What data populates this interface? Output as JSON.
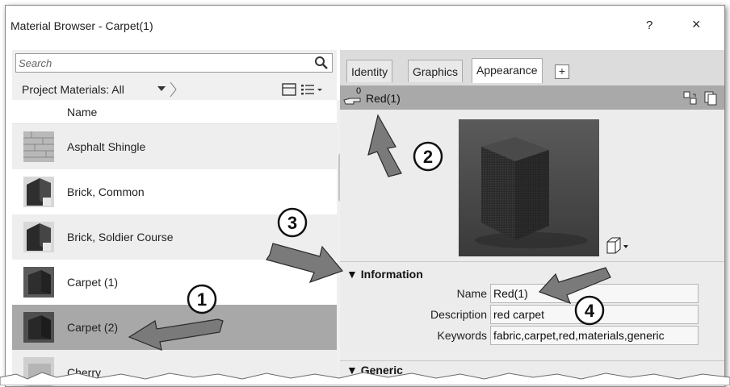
{
  "window": {
    "title": "Material Browser - Carpet(1)",
    "help": "?",
    "close": "×"
  },
  "search": {
    "placeholder": "Search"
  },
  "filter": {
    "label": "Project Materials: All"
  },
  "list": {
    "column_header": "Name",
    "items": [
      {
        "label": "Asphalt Shingle",
        "selected": false
      },
      {
        "label": "Brick, Common",
        "selected": false
      },
      {
        "label": "Brick, Soldier Course",
        "selected": false
      },
      {
        "label": "Carpet (1)",
        "selected": false
      },
      {
        "label": "Carpet (2)",
        "selected": true
      },
      {
        "label": "Cherry",
        "selected": false
      }
    ]
  },
  "tabs": [
    {
      "label": "Identity",
      "active": false
    },
    {
      "label": "Graphics",
      "active": false
    },
    {
      "label": "Appearance",
      "active": true
    }
  ],
  "tab_add": "+",
  "asset": {
    "count": "0",
    "name": "Red(1)"
  },
  "information": {
    "header": "Information",
    "name_label": "Name",
    "name_value": "Red(1)",
    "description_label": "Description",
    "description_value": "red carpet",
    "keywords_label": "Keywords",
    "keywords_value": "fabric,carpet,red,materials,generic"
  },
  "generic": {
    "header": "Generic"
  },
  "callouts": [
    "1",
    "2",
    "3",
    "4"
  ],
  "colors": {
    "selected_row": "#a8a8a8",
    "alt_row": "#eeeeee",
    "asset_bar": "#a9a9a9",
    "callout_arrow": "#7a7a7a"
  }
}
